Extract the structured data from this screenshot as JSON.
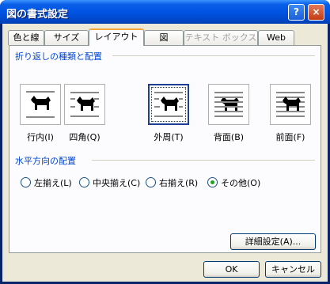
{
  "window": {
    "title": "図の書式設定",
    "help_glyph": "?",
    "close_glyph": "×"
  },
  "tabs": [
    {
      "label": "色と線"
    },
    {
      "label": "サイズ"
    },
    {
      "label": "レイアウト"
    },
    {
      "label": "図"
    },
    {
      "label": "テキスト ボックス"
    },
    {
      "label": "Web"
    }
  ],
  "active_tab": "レイアウト",
  "wrap_group": {
    "title": "折り返しの種類と配置",
    "options": [
      {
        "label": "行内(I)",
        "icon": "inline-wrap-icon"
      },
      {
        "label": "四角(Q)",
        "icon": "square-wrap-icon"
      },
      {
        "label": "外周(T)",
        "icon": "tight-wrap-icon",
        "selected": true
      },
      {
        "label": "背面(B)",
        "icon": "behind-text-icon"
      },
      {
        "label": "前面(F)",
        "icon": "in-front-of-text-icon"
      }
    ]
  },
  "align_group": {
    "title": "水平方向の配置",
    "options": [
      {
        "label": "左揃え(L)"
      },
      {
        "label": "中央揃え(C)"
      },
      {
        "label": "右揃え(R)"
      },
      {
        "label": "その他(O)",
        "selected": true
      }
    ]
  },
  "buttons": {
    "advanced": "詳細設定(A)...",
    "ok": "OK",
    "cancel": "キャンセル"
  },
  "colors": {
    "title_bar": "#0054e3",
    "group_title": "#0046d5",
    "dialog_bg": "#ece9d8",
    "active_tab_accent": "#f3a73b"
  }
}
